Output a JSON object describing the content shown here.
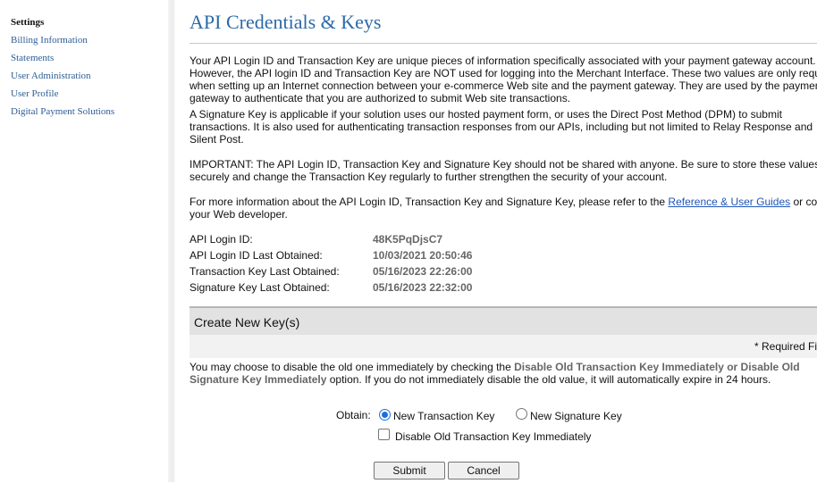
{
  "sidebar": {
    "heading": "Settings",
    "items": [
      {
        "label": "Billing Information"
      },
      {
        "label": "Statements"
      },
      {
        "label": "User Administration"
      },
      {
        "label": "User Profile"
      },
      {
        "label": "Digital Payment Solutions"
      }
    ]
  },
  "page": {
    "title": "API Credentials & Keys",
    "intro_lines": [
      "Your API Login ID and Transaction Key are unique pieces of information specifically associated with your payment gateway account.",
      "However, the API login ID and Transaction Key are NOT used for logging into the Merchant Interface. These two values are only requ",
      "when setting up an Internet connection between your e-commerce Web site and the payment gateway. They are used by the paymen",
      "gateway to authenticate that you are authorized to submit Web site transactions."
    ],
    "signature_lines": [
      "A Signature Key is applicable if your solution uses our hosted payment form, or uses the Direct Post Method (DPM) to submit",
      "transactions. It is also used for authenticating transaction responses from our APIs, including but not limited to Relay Response and",
      "Silent Post."
    ],
    "important_lines": [
      "IMPORTANT: The API Login ID, Transaction Key and Signature Key should not be shared with anyone. Be sure to store these values",
      "securely and change the Transaction Key regularly to further strengthen the security of your account."
    ],
    "more_info_prefix": "For more information about the API Login ID, Transaction Key and Signature Key, please refer to the ",
    "more_info_link": "Reference & User Guides",
    "more_info_suffix": " or co",
    "more_info_line2": "your Web developer."
  },
  "credentials": [
    {
      "label": "API Login ID:",
      "value": "48K5PqDjsC7"
    },
    {
      "label": "API Login ID Last Obtained:",
      "value": "10/03/2021 20:50:46"
    },
    {
      "label": "Transaction Key Last Obtained:",
      "value": "05/16/2023 22:26:00"
    },
    {
      "label": "Signature Key Last Obtained:",
      "value": "05/16/2023 22:32:00"
    }
  ],
  "create_section": {
    "title": "Create New Key(s)",
    "required_note": "* Required Fi",
    "note_prefix": "You may choose to disable the old one immediately by checking the ",
    "note_bold1": "Disable Old Transaction Key Immediately or Disable Old",
    "note_bold2": "Signature Key Immediately",
    "note_suffix": " option. If you do not immediately disable the old value, it will automatically expire in 24 hours.",
    "obtain_label": "Obtain:",
    "options": [
      {
        "label": "New Transaction Key",
        "selected": true
      },
      {
        "label": "New Signature Key",
        "selected": false
      }
    ],
    "disable_checkbox": {
      "label": "Disable Old Transaction Key Immediately",
      "checked": false
    },
    "submit_label": "Submit",
    "cancel_label": "Cancel"
  }
}
